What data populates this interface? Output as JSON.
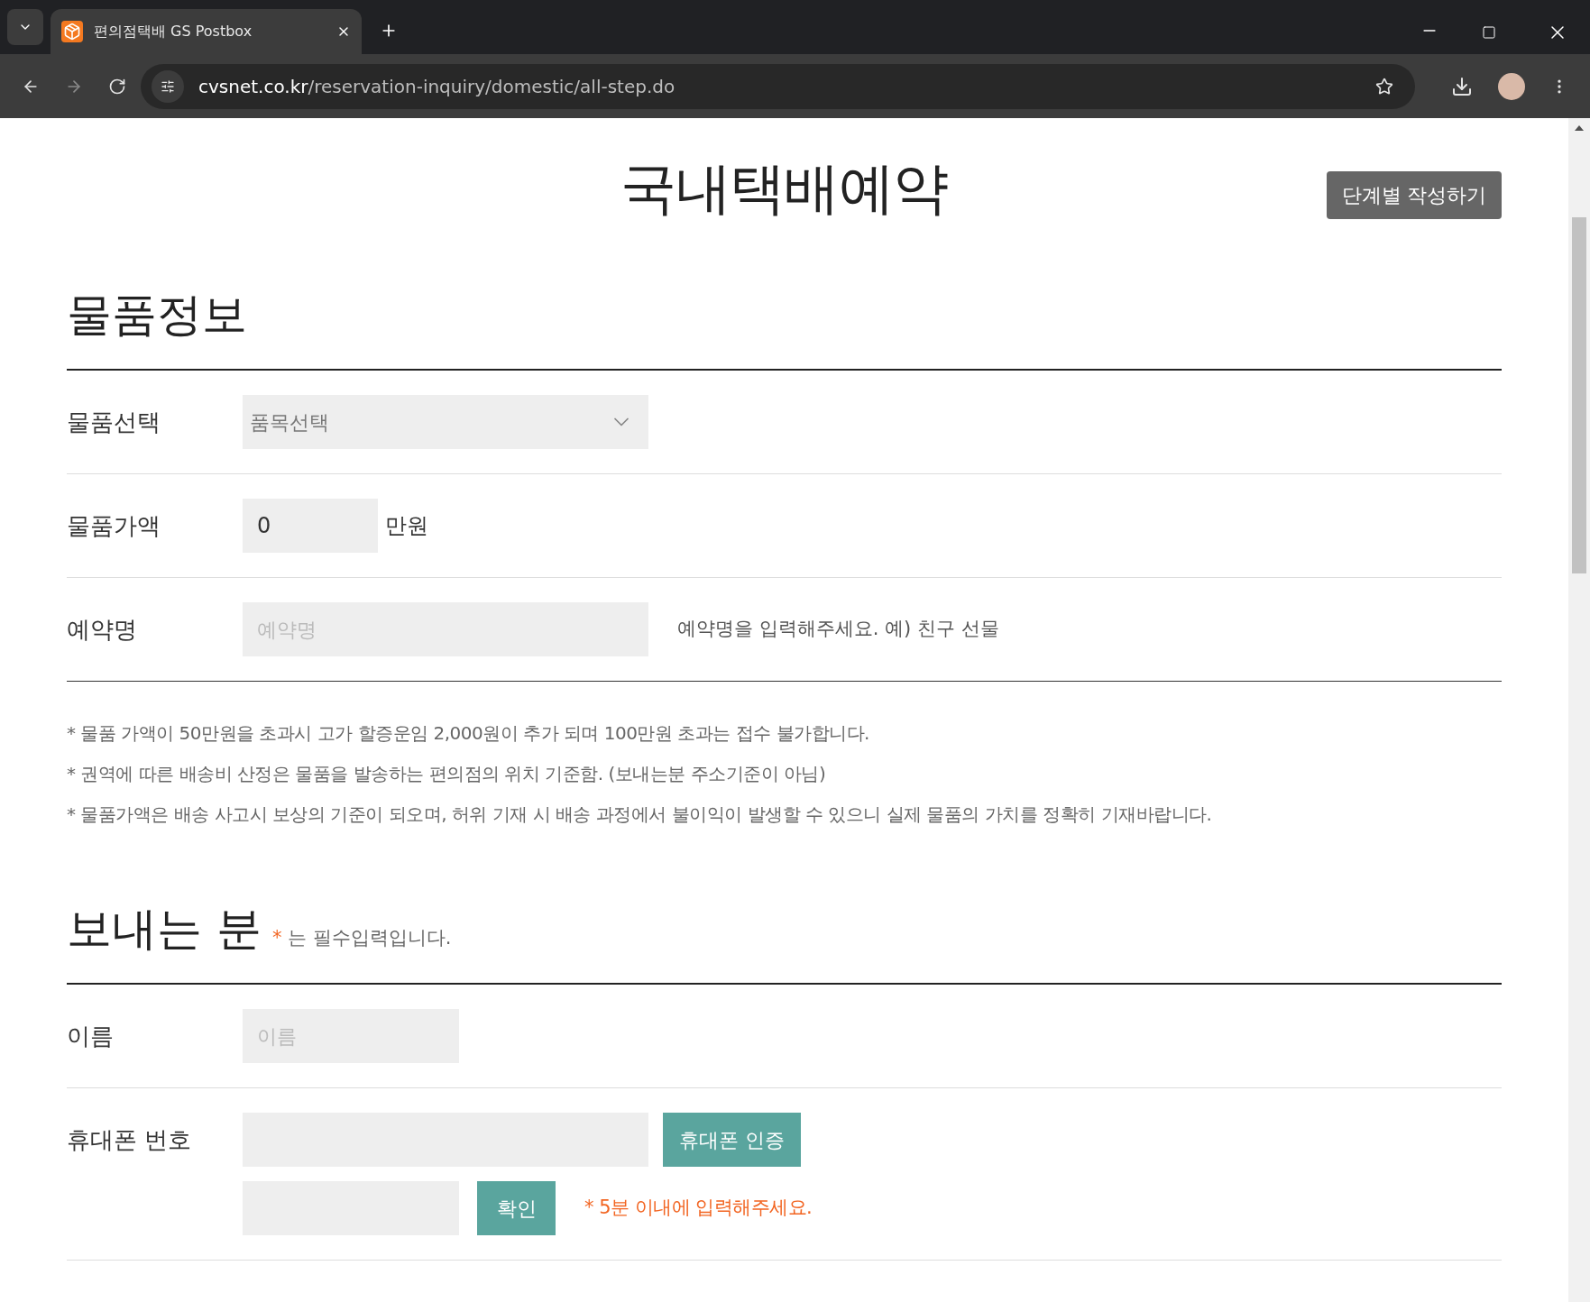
{
  "browser": {
    "tab_title": "편의점택배 GS Postbox",
    "url_host": "cvsnet.co.kr",
    "url_path": "/reservation-inquiry/domestic/all-step.do"
  },
  "page_title": "국내택배예약",
  "step_button": "단계별 작성하기",
  "item_section": {
    "heading": "물품정보",
    "rows": [
      {
        "kind": "select",
        "label": "물품선택",
        "value": "품목선택"
      },
      {
        "kind": "unit",
        "label": "물품가액",
        "value": "0",
        "unit": "만원"
      },
      {
        "kind": "hint",
        "label": "예약명",
        "placeholder": "예약명",
        "hint": "예약명을 입력해주세요. 예) 친구 선물"
      }
    ],
    "notes": [
      "* 물품 가액이 50만원을 초과시 고가 할증운임 2,000원이 추가 되며 100만원 초과는 접수 불가합니다.",
      "* 권역에 따른 배송비 산정은 물품을 발송하는 편의점의 위치 기준함. (보내는분 주소기준이 아님)",
      "* 물품가액은 배송 사고시 보상의 기준이 되오며, 허위 기재 시 배송 과정에서 불이익이 발생할 수 있으니 실제 물품의 가치를 정확히 기재바랍니다."
    ]
  },
  "sender_section": {
    "heading": "보내는 분",
    "required_mark": "*",
    "required_note": "는 필수입력입니다.",
    "name_row": {
      "label": "이름",
      "placeholder": "이름"
    },
    "phone_row": {
      "label": "휴대폰 번호",
      "verify_button": "휴대폰 인증",
      "confirm_button": "확인",
      "timer_note": "* 5분 이내에 입력해주세요."
    }
  }
}
